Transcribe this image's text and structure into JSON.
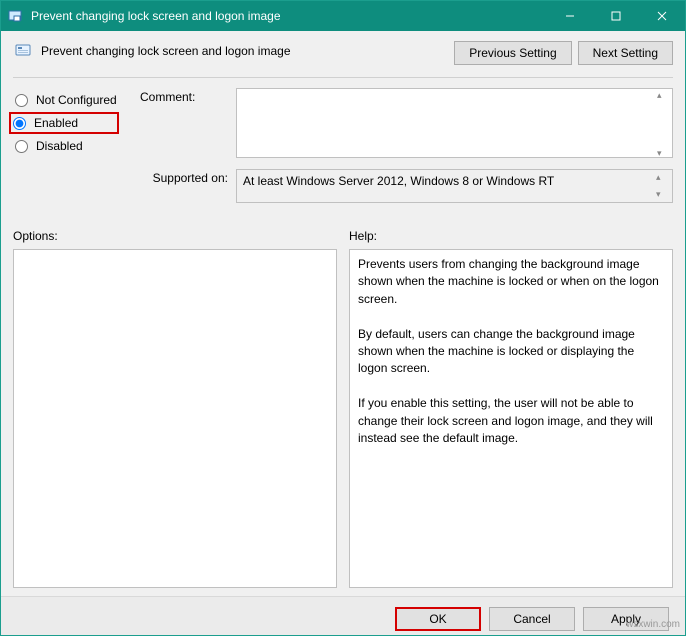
{
  "window": {
    "title": "Prevent changing lock screen and logon image"
  },
  "header": {
    "policy_title": "Prevent changing lock screen and logon image",
    "prev_button": "Previous Setting",
    "next_button": "Next Setting"
  },
  "radios": {
    "not_configured": "Not Configured",
    "enabled": "Enabled",
    "disabled": "Disabled",
    "selected": "enabled"
  },
  "fields": {
    "comment_label": "Comment:",
    "comment_value": "",
    "supported_label": "Supported on:",
    "supported_value": "At least Windows Server 2012, Windows 8 or Windows RT"
  },
  "labels": {
    "options": "Options:",
    "help": "Help:"
  },
  "options_panel": "",
  "help_panel": "Prevents users from changing the background image shown when the machine is locked or when on the logon screen.\n\nBy default, users can change the background image shown when the machine is locked or displaying the logon screen.\n\nIf you enable this setting, the user will not be able to change their lock screen and logon image, and they will instead see the default image.",
  "footer": {
    "ok": "OK",
    "cancel": "Cancel",
    "apply": "Apply"
  },
  "watermark": "wsxwin.com"
}
